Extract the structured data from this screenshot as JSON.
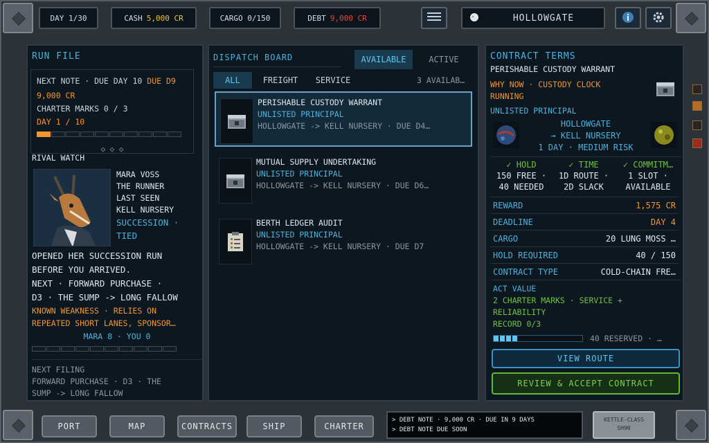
{
  "topbar": {
    "day": "DAY 1/30",
    "cash_label": "CASH",
    "cash_value": "5,000 CR",
    "cargo": "CARGO 0/150",
    "debt_label": "DEBT",
    "debt_value": "9,000 CR",
    "location": "HOLLOWGATE",
    "icons": [
      "menu-icon",
      "moon-icon",
      "info-icon",
      "gear-icon"
    ]
  },
  "run_file": {
    "title": "RUN FILE",
    "next_note_label": "NEXT NOTE · DUE DAY 10",
    "next_note_due": "DUE D9",
    "note_amount": "9,000 CR",
    "charter_marks": "CHARTER MARKS 0 / 3",
    "day_progress": "DAY 1 / 10",
    "progress_fraction": 0.1,
    "pager": "◇ ◇ ◇"
  },
  "rival_watch": {
    "title": "RIVAL WATCH",
    "name": "MARA VOSS",
    "role": "THE RUNNER",
    "last_seen_label": "LAST SEEN",
    "last_seen_value": "KELL NURSERY",
    "status_1": "SUCCESSION ·",
    "status_2": "TIED",
    "blurb_1": "OPENED HER SUCCESSION RUN",
    "blurb_2": "BEFORE YOU ARRIVED.",
    "next_1": "NEXT · FORWARD PURCHASE ·",
    "next_2": "D3 · THE SUMP -> LONG FALLOW",
    "weak_1": "KNOWN WEAKNESS · RELIES ON",
    "weak_2": "REPEATED SHORT LANES, SPONSOR…",
    "score": "MARA 8 · YOU 0",
    "filing_1": "NEXT FILING",
    "filing_2": "FORWARD PURCHASE · D3 · THE",
    "filing_3": "SUMP -> LONG FALLOW"
  },
  "dispatch": {
    "title": "DISPATCH BOARD",
    "tab_available": "AVAILABLE",
    "tab_active": "ACTIVE",
    "filter_all": "ALL",
    "filter_freight": "FREIGHT",
    "filter_service": "SERVICE",
    "count": "3 AVAILAB…",
    "cards": [
      {
        "title": "PERISHABLE CUSTODY WARRANT",
        "principal": "UNLISTED PRINCIPAL",
        "route": "HOLLOWGATE  ->  KELL NURSERY  ·  DUE D4…",
        "icon": "crate-icon"
      },
      {
        "title": "MUTUAL SUPPLY UNDERTAKING",
        "principal": "UNLISTED PRINCIPAL",
        "route": "HOLLOWGATE  ->  KELL NURSERY  ·  DUE D6…",
        "icon": "crate-icon"
      },
      {
        "title": "BERTH LEDGER AUDIT",
        "principal": "UNLISTED PRINCIPAL",
        "route": "HOLLOWGATE  ->  KELL NURSERY  ·  DUE D7",
        "icon": "clipboard-icon"
      }
    ]
  },
  "terms": {
    "title": "CONTRACT TERMS",
    "contract_name": "PERISHABLE CUSTODY WARRANT",
    "why_1": "WHY NOW · CUSTODY CLOCK",
    "why_2": "RUNNING",
    "principal": "UNLISTED PRINCIPAL",
    "origin": "HOLLOWGATE",
    "dest": "→ KELL NURSERY",
    "meta": "1 DAY  ·  MEDIUM RISK",
    "checks": [
      "✓ HOLD",
      "✓ TIME",
      "✓ COMMITM…"
    ],
    "check_a": [
      "150 FREE ·",
      "1D ROUTE ·",
      "1 SLOT ·"
    ],
    "check_b": [
      "40 NEEDED",
      "2D SLACK",
      "AVAILABLE"
    ],
    "rows": [
      {
        "label": "REWARD",
        "value": "1,575 CR"
      },
      {
        "label": "DEADLINE",
        "value": "DAY 4"
      },
      {
        "label": "CARGO",
        "value": "20 LUNG MOSS  …"
      },
      {
        "label": "HOLD REQUIRED",
        "value": "40 / 150"
      },
      {
        "label": "CONTRACT TYPE",
        "value": "COLD-CHAIN FRE…"
      }
    ],
    "act_value_label": "ACT VALUE",
    "act_1": "2 CHARTER MARKS · SERVICE +",
    "act_2": "RELIABILITY",
    "act_3": "RECORD 0/3",
    "reserved": "40 RESERVED  ·  …",
    "reserved_fraction": 0.27,
    "view_route": "VIEW ROUTE",
    "accept": "REVIEW & ACCEPT CONTRACT"
  },
  "bottombar": {
    "port": "PORT",
    "map": "MAP",
    "contracts": "CONTRACTS",
    "ship": "SHIP",
    "charter": "CHARTER",
    "log_1": "> DEBT NOTE · 9,000 CR · DUE IN 9 DAYS",
    "log_2": "> DEBT NOTE DUE SOON",
    "ship_class": "KETTLE-CLASS",
    "ship_id": "SH90"
  },
  "colors": {
    "accent": "#4ab3dd",
    "warning": "#f3962e",
    "ok": "#6fc23f",
    "danger": "#e0473d"
  }
}
